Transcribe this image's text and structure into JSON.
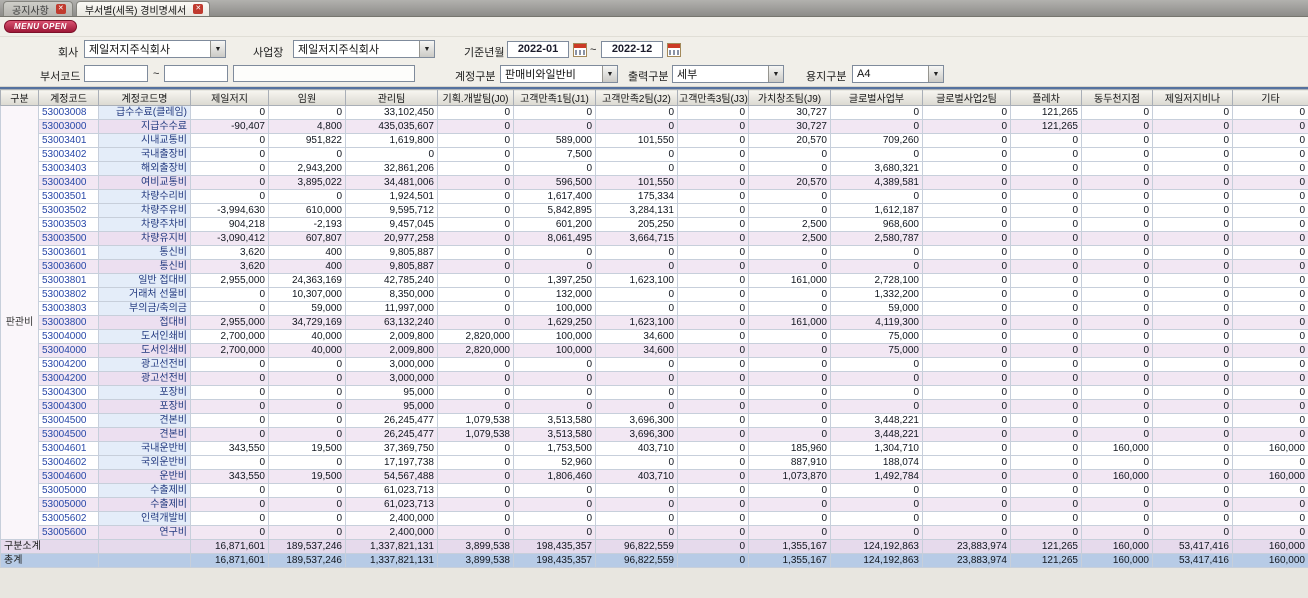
{
  "tabs": [
    {
      "label": "공지사항"
    },
    {
      "label": "부서별(세목) 경비명세서"
    }
  ],
  "menu_open_label": "MENU OPEN",
  "filters": {
    "company_label": "회사",
    "company_value": "제일저지주식회사",
    "site_label": "사업장",
    "site_value": "제일저지주식회사",
    "period_label": "기준년월",
    "period_from": "2022-01",
    "period_to": "2022-12",
    "tilde": "~",
    "dept_code_label": "부서코드",
    "dept_from": "",
    "dept_to": "",
    "account_label": "계정구분",
    "account_value": "판매비와일반비",
    "output_label": "출력구분",
    "output_value": "세부",
    "paper_label": "용지구분",
    "paper_value": "A4"
  },
  "table": {
    "headers": [
      "구분",
      "계정코드",
      "계정코드명",
      "제일저지",
      "임원",
      "관리팀",
      "기획.개발팀(J0)",
      "고객만족1팀(J1)",
      "고객만족2팀(J2)",
      "고객만족3팀(J3)",
      "가치창조팀(J9)",
      "글로벌사업부",
      "글로벌사업2팀",
      "플레차",
      "동두천지점",
      "제일저지비나",
      "기타"
    ],
    "group_label": "판관비",
    "rows": [
      {
        "code": "53003008",
        "name": "급수수료(클레임)",
        "type": "detail",
        "values": [
          "0",
          "0",
          "33,102,450",
          "0",
          "0",
          "0",
          "0",
          "30,727",
          "0",
          "0",
          "121,265",
          "0",
          "0",
          "0"
        ]
      },
      {
        "code": "53003000",
        "name": "지급수수료",
        "type": "subtotal",
        "values": [
          "-90,407",
          "4,800",
          "435,035,607",
          "0",
          "0",
          "0",
          "0",
          "30,727",
          "0",
          "0",
          "121,265",
          "0",
          "0",
          "0"
        ]
      },
      {
        "code": "53003401",
        "name": "시내교통비",
        "type": "detail",
        "values": [
          "0",
          "951,822",
          "1,619,800",
          "0",
          "589,000",
          "101,550",
          "0",
          "20,570",
          "709,260",
          "0",
          "0",
          "0",
          "0",
          "0"
        ]
      },
      {
        "code": "53003402",
        "name": "국내출장비",
        "type": "detail",
        "values": [
          "0",
          "0",
          "0",
          "0",
          "7,500",
          "0",
          "0",
          "0",
          "0",
          "0",
          "0",
          "0",
          "0",
          "0"
        ]
      },
      {
        "code": "53003403",
        "name": "해외출장비",
        "type": "detail",
        "values": [
          "0",
          "2,943,200",
          "32,861,206",
          "0",
          "0",
          "0",
          "0",
          "0",
          "3,680,321",
          "0",
          "0",
          "0",
          "0",
          "0"
        ]
      },
      {
        "code": "53003400",
        "name": "여비교통비",
        "type": "subtotal",
        "values": [
          "0",
          "3,895,022",
          "34,481,006",
          "0",
          "596,500",
          "101,550",
          "0",
          "20,570",
          "4,389,581",
          "0",
          "0",
          "0",
          "0",
          "0"
        ]
      },
      {
        "code": "53003501",
        "name": "차량수리비",
        "type": "detail",
        "values": [
          "0",
          "0",
          "1,924,501",
          "0",
          "1,617,400",
          "175,334",
          "0",
          "0",
          "0",
          "0",
          "0",
          "0",
          "0",
          "0"
        ]
      },
      {
        "code": "53003502",
        "name": "차량주유비",
        "type": "detail",
        "values": [
          "-3,994,630",
          "610,000",
          "9,595,712",
          "0",
          "5,842,895",
          "3,284,131",
          "0",
          "0",
          "1,612,187",
          "0",
          "0",
          "0",
          "0",
          "0"
        ]
      },
      {
        "code": "53003503",
        "name": "차량주차비",
        "type": "detail",
        "values": [
          "904,218",
          "-2,193",
          "9,457,045",
          "0",
          "601,200",
          "205,250",
          "0",
          "2,500",
          "968,600",
          "0",
          "0",
          "0",
          "0",
          "0"
        ]
      },
      {
        "code": "53003500",
        "name": "차량유지비",
        "type": "subtotal",
        "values": [
          "-3,090,412",
          "607,807",
          "20,977,258",
          "0",
          "8,061,495",
          "3,664,715",
          "0",
          "2,500",
          "2,580,787",
          "0",
          "0",
          "0",
          "0",
          "0"
        ]
      },
      {
        "code": "53003601",
        "name": "통신비",
        "type": "detail",
        "values": [
          "3,620",
          "400",
          "9,805,887",
          "0",
          "0",
          "0",
          "0",
          "0",
          "0",
          "0",
          "0",
          "0",
          "0",
          "0"
        ]
      },
      {
        "code": "53003600",
        "name": "통신비",
        "type": "subtotal",
        "values": [
          "3,620",
          "400",
          "9,805,887",
          "0",
          "0",
          "0",
          "0",
          "0",
          "0",
          "0",
          "0",
          "0",
          "0",
          "0"
        ]
      },
      {
        "code": "53003801",
        "name": "일반 접대비",
        "type": "detail",
        "values": [
          "2,955,000",
          "24,363,169",
          "42,785,240",
          "0",
          "1,397,250",
          "1,623,100",
          "0",
          "161,000",
          "2,728,100",
          "0",
          "0",
          "0",
          "0",
          "0"
        ]
      },
      {
        "code": "53003802",
        "name": "거래처 선물비",
        "type": "detail",
        "values": [
          "0",
          "10,307,000",
          "8,350,000",
          "0",
          "132,000",
          "0",
          "0",
          "0",
          "1,332,200",
          "0",
          "0",
          "0",
          "0",
          "0"
        ]
      },
      {
        "code": "53003803",
        "name": "부의금/축의금",
        "type": "detail",
        "values": [
          "0",
          "59,000",
          "11,997,000",
          "0",
          "100,000",
          "0",
          "0",
          "0",
          "59,000",
          "0",
          "0",
          "0",
          "0",
          "0"
        ]
      },
      {
        "code": "53003800",
        "name": "접대비",
        "type": "subtotal",
        "values": [
          "2,955,000",
          "34,729,169",
          "63,132,240",
          "0",
          "1,629,250",
          "1,623,100",
          "0",
          "161,000",
          "4,119,300",
          "0",
          "0",
          "0",
          "0",
          "0"
        ]
      },
      {
        "code": "53004000",
        "name": "도서인쇄비",
        "type": "detail",
        "values": [
          "2,700,000",
          "40,000",
          "2,009,800",
          "2,820,000",
          "100,000",
          "34,600",
          "0",
          "0",
          "75,000",
          "0",
          "0",
          "0",
          "0",
          "0"
        ]
      },
      {
        "code": "53004000",
        "name": "도서인쇄비",
        "type": "subtotal",
        "values": [
          "2,700,000",
          "40,000",
          "2,009,800",
          "2,820,000",
          "100,000",
          "34,600",
          "0",
          "0",
          "75,000",
          "0",
          "0",
          "0",
          "0",
          "0"
        ]
      },
      {
        "code": "53004200",
        "name": "광고선전비",
        "type": "detail",
        "values": [
          "0",
          "0",
          "3,000,000",
          "0",
          "0",
          "0",
          "0",
          "0",
          "0",
          "0",
          "0",
          "0",
          "0",
          "0"
        ]
      },
      {
        "code": "53004200",
        "name": "광고선전비",
        "type": "subtotal",
        "values": [
          "0",
          "0",
          "3,000,000",
          "0",
          "0",
          "0",
          "0",
          "0",
          "0",
          "0",
          "0",
          "0",
          "0",
          "0"
        ]
      },
      {
        "code": "53004300",
        "name": "포장비",
        "type": "detail",
        "values": [
          "0",
          "0",
          "95,000",
          "0",
          "0",
          "0",
          "0",
          "0",
          "0",
          "0",
          "0",
          "0",
          "0",
          "0"
        ]
      },
      {
        "code": "53004300",
        "name": "포장비",
        "type": "subtotal",
        "values": [
          "0",
          "0",
          "95,000",
          "0",
          "0",
          "0",
          "0",
          "0",
          "0",
          "0",
          "0",
          "0",
          "0",
          "0"
        ]
      },
      {
        "code": "53004500",
        "name": "견본비",
        "type": "detail",
        "values": [
          "0",
          "0",
          "26,245,477",
          "1,079,538",
          "3,513,580",
          "3,696,300",
          "0",
          "0",
          "3,448,221",
          "0",
          "0",
          "0",
          "0",
          "0"
        ]
      },
      {
        "code": "53004500",
        "name": "견본비",
        "type": "subtotal",
        "values": [
          "0",
          "0",
          "26,245,477",
          "1,079,538",
          "3,513,580",
          "3,696,300",
          "0",
          "0",
          "3,448,221",
          "0",
          "0",
          "0",
          "0",
          "0"
        ]
      },
      {
        "code": "53004601",
        "name": "국내운반비",
        "type": "detail",
        "values": [
          "343,550",
          "19,500",
          "37,369,750",
          "0",
          "1,753,500",
          "403,710",
          "0",
          "185,960",
          "1,304,710",
          "0",
          "0",
          "160,000",
          "0",
          "160,000"
        ]
      },
      {
        "code": "53004602",
        "name": "국외운반비",
        "type": "detail",
        "values": [
          "0",
          "0",
          "17,197,738",
          "0",
          "52,960",
          "0",
          "0",
          "887,910",
          "188,074",
          "0",
          "0",
          "0",
          "0",
          "0"
        ]
      },
      {
        "code": "53004600",
        "name": "운반비",
        "type": "subtotal",
        "values": [
          "343,550",
          "19,500",
          "54,567,488",
          "0",
          "1,806,460",
          "403,710",
          "0",
          "1,073,870",
          "1,492,784",
          "0",
          "0",
          "160,000",
          "0",
          "160,000"
        ]
      },
      {
        "code": "53005000",
        "name": "수출제비",
        "type": "detail",
        "values": [
          "0",
          "0",
          "61,023,713",
          "0",
          "0",
          "0",
          "0",
          "0",
          "0",
          "0",
          "0",
          "0",
          "0",
          "0"
        ]
      },
      {
        "code": "53005000",
        "name": "수출제비",
        "type": "subtotal",
        "values": [
          "0",
          "0",
          "61,023,713",
          "0",
          "0",
          "0",
          "0",
          "0",
          "0",
          "0",
          "0",
          "0",
          "0",
          "0"
        ]
      },
      {
        "code": "53005602",
        "name": "인력개발비",
        "type": "detail",
        "values": [
          "0",
          "0",
          "2,400,000",
          "0",
          "0",
          "0",
          "0",
          "0",
          "0",
          "0",
          "0",
          "0",
          "0",
          "0"
        ]
      },
      {
        "code": "53005600",
        "name": "연구비",
        "type": "subtotal",
        "values": [
          "0",
          "0",
          "2,400,000",
          "0",
          "0",
          "0",
          "0",
          "0",
          "0",
          "0",
          "0",
          "0",
          "0",
          "0"
        ]
      }
    ],
    "subtotal_row": {
      "label": "구분소계",
      "values": [
        "16,871,601",
        "189,537,246",
        "1,337,821,131",
        "3,899,538",
        "198,435,357",
        "96,822,559",
        "0",
        "1,355,167",
        "124,192,863",
        "23,883,974",
        "121,265",
        "160,000",
        "53,417,416",
        "160,000"
      ]
    },
    "total_row": {
      "label": "총계",
      "values": [
        "16,871,601",
        "189,537,246",
        "1,337,821,131",
        "3,899,538",
        "198,435,357",
        "96,822,559",
        "0",
        "1,355,167",
        "124,192,863",
        "23,883,974",
        "121,265",
        "160,000",
        "53,417,416",
        "160,000"
      ]
    }
  },
  "colors": {
    "accent_red": "#c03a2e",
    "subtotal_bg": "#f2e7f3",
    "total_bg": "#b7cbe6",
    "name_col_bg": "#e4edf9",
    "code_text": "#2747a8"
  }
}
